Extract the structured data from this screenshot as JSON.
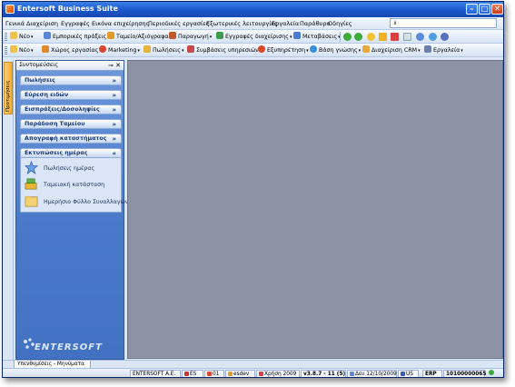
{
  "window": {
    "title": "Entersoft Business Suite"
  },
  "menubar": {
    "items": [
      "Γενικά",
      "Διαχείριση",
      "Εγγραφές",
      "Εικόνα επιχείρησης",
      "Περιοδικές εργασίες",
      "Εξωτερικές λειτουργίες",
      "Εργαλεία",
      "Παράθυρο",
      "Οδηγίες"
    ],
    "search_text": "ℹ"
  },
  "toolbar1": {
    "items": [
      "Νέο",
      "Εμπορικές πράξεις",
      "Ταμείο/Αξιόγραφα",
      "Παραγωγή",
      "Εγγραφές διαχείρισης",
      "Μεταβάσεις"
    ]
  },
  "toolbar2": {
    "items": [
      "Νέο",
      "Χώρος εργασίας",
      "Marketing",
      "Πωλήσεις",
      "Συμβάσεις υπηρεσιών",
      "Εξυπηρέτηση",
      "Βάση γνώσης",
      "Διαχείριση CRM",
      "Εργαλεία"
    ]
  },
  "sidetab": {
    "label": "Προτιμήσεις"
  },
  "panel": {
    "title": "Συντομεύσεις",
    "groups": [
      {
        "label": "Πωλήσεις",
        "chevron": "»"
      },
      {
        "label": "Εύρεση ειδών",
        "chevron": "»"
      },
      {
        "label": "Εισπράξεις/Δοσοληψίες",
        "chevron": "»"
      },
      {
        "label": "Παράδοση Ταμείου",
        "chevron": "»"
      },
      {
        "label": "Απογραφή καταστήματος",
        "chevron": "»"
      },
      {
        "label": "Εκτυπώσεις ημέρας",
        "chevron": "«"
      }
    ],
    "expanded_items": [
      "Πωλήσεις ημέρας",
      "Ταμειακή κατάσταση",
      "Ημερήσιο Φύλλο Συναλλαγών"
    ],
    "logo_text": "ENTERSOFT"
  },
  "bottom": {
    "tab": "Υπενθυμίσεις - Μηνύματα"
  },
  "statusbar": {
    "company": "ENTERSOFT A.E.",
    "lang": "ES",
    "branch": "01",
    "user": "esdev",
    "year": "Χρήση 2009",
    "version": "v3.8.7 - 11 (5)",
    "date": "Δευ 12/10/2009",
    "locale": "US",
    "module": "ERP",
    "code": "10100000065"
  },
  "colors": {
    "titlebar": "#1a56c9",
    "panel": "#4a79c9",
    "workspace": "#8b93a4"
  }
}
